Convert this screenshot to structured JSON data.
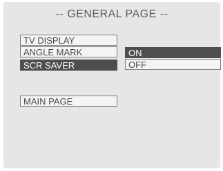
{
  "header": {
    "title": "-- GENERAL PAGE --"
  },
  "menu": {
    "items": [
      {
        "label": "TV DISPLAY",
        "selected": false
      },
      {
        "label": "ANGLE MARK",
        "selected": false
      },
      {
        "label": "SCR SAVER",
        "selected": true
      }
    ]
  },
  "submenu": {
    "options": [
      {
        "label": "ON",
        "selected": true
      },
      {
        "label": "OFF",
        "selected": false
      }
    ]
  },
  "footer": {
    "main_page_label": "MAIN PAGE"
  },
  "colors": {
    "screen_bg": "#e6e6e6",
    "highlight_bg": "#4e4e4e",
    "highlight_text": "#ffffff",
    "item_border": "#7a7a7a"
  }
}
